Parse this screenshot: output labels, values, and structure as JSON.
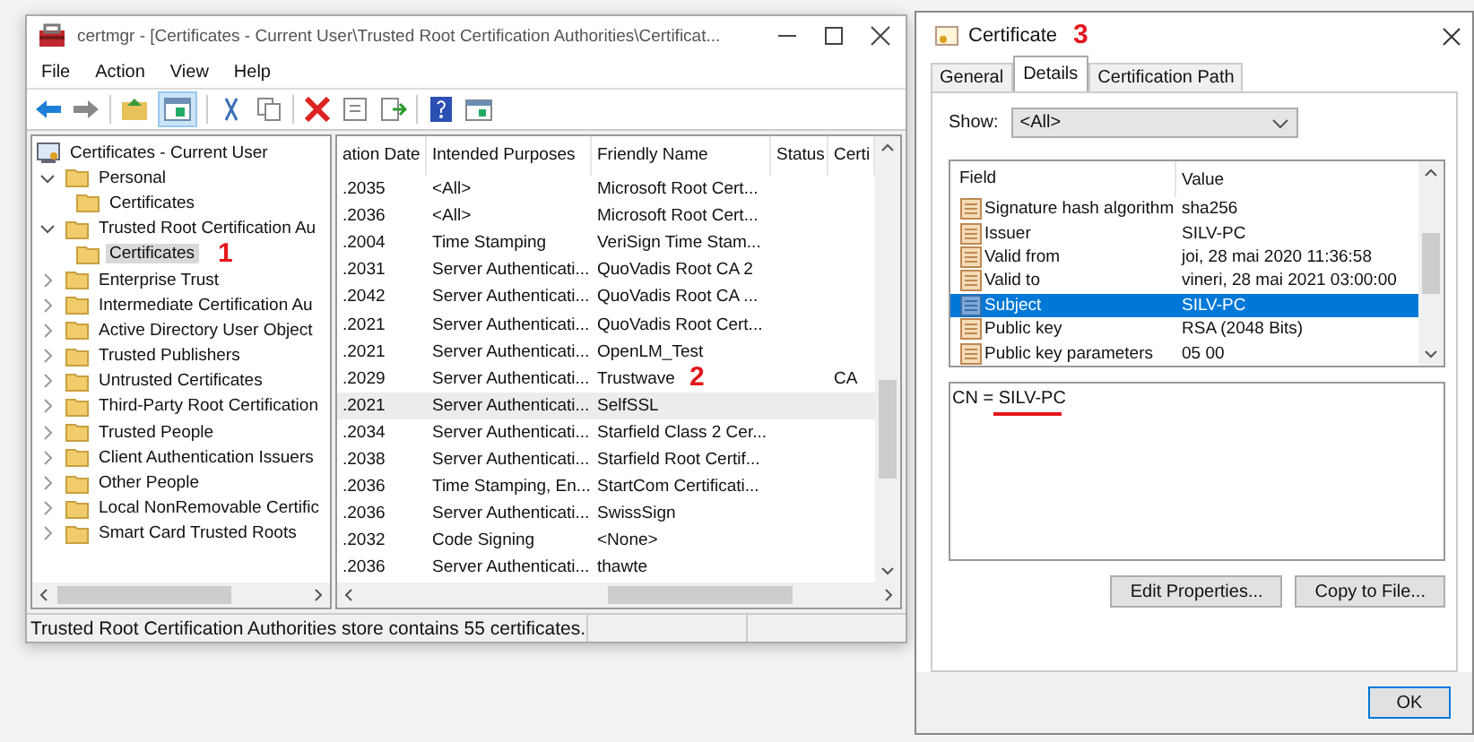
{
  "main_window": {
    "title": "certmgr - [Certificates - Current User\\Trusted Root Certification Authorities\\Certificat...",
    "menu": [
      "File",
      "Action",
      "View",
      "Help"
    ],
    "tree": {
      "label": "Certificates - Current User",
      "children": [
        {
          "label": "Personal",
          "expanded": true,
          "selected": false,
          "children": [
            {
              "label": "Certificates",
              "selected": false
            }
          ]
        },
        {
          "label": "Trusted Root Certification Au",
          "expanded": true,
          "selected": false,
          "children": [
            {
              "label": "Certificates",
              "selected": true,
              "annotation": "1"
            }
          ]
        },
        {
          "label": "Enterprise Trust",
          "expanded": false,
          "selected": false
        },
        {
          "label": "Intermediate Certification Au",
          "expanded": false,
          "selected": false
        },
        {
          "label": "Active Directory User Object",
          "expanded": false,
          "selected": false
        },
        {
          "label": "Trusted Publishers",
          "expanded": false,
          "selected": false
        },
        {
          "label": "Untrusted Certificates",
          "expanded": false,
          "selected": false
        },
        {
          "label": "Third-Party Root Certification",
          "expanded": false,
          "selected": false
        },
        {
          "label": "Trusted People",
          "expanded": false,
          "selected": false
        },
        {
          "label": "Client Authentication Issuers",
          "expanded": false,
          "selected": false
        },
        {
          "label": "Other People",
          "expanded": false,
          "selected": false
        },
        {
          "label": "Local NonRemovable Certific",
          "expanded": false,
          "selected": false
        },
        {
          "label": "Smart Card Trusted Roots",
          "expanded": false,
          "selected": false
        }
      ]
    },
    "table": {
      "columns": [
        "ation Date",
        "Intended Purposes",
        "Friendly Name",
        "Status",
        "Certi"
      ],
      "rows": [
        {
          "cells": [
            ".2035",
            "<All>",
            "Microsoft Root Cert...",
            "",
            ""
          ],
          "selected": false
        },
        {
          "cells": [
            ".2036",
            "<All>",
            "Microsoft Root Cert...",
            "",
            ""
          ],
          "selected": false
        },
        {
          "cells": [
            ".2004",
            "Time Stamping",
            "VeriSign Time Stam...",
            "",
            ""
          ],
          "selected": false
        },
        {
          "cells": [
            ".2031",
            "Server Authenticati...",
            "QuoVadis Root CA 2",
            "",
            ""
          ],
          "selected": false
        },
        {
          "cells": [
            ".2042",
            "Server Authenticati...",
            "QuoVadis Root CA ...",
            "",
            ""
          ],
          "selected": false
        },
        {
          "cells": [
            ".2021",
            "Server Authenticati...",
            "QuoVadis Root Cert...",
            "",
            ""
          ],
          "selected": false
        },
        {
          "cells": [
            ".2021",
            "Server Authenticati...",
            "OpenLM_Test",
            "",
            ""
          ],
          "selected": false
        },
        {
          "cells": [
            ".2029",
            "Server Authenticati...",
            "Trustwave",
            "",
            "CA"
          ],
          "selected": false,
          "annotation": "2"
        },
        {
          "cells": [
            ".2021",
            "Server Authenticati...",
            "SelfSSL",
            "",
            ""
          ],
          "selected": true
        },
        {
          "cells": [
            ".2034",
            "Server Authenticati...",
            "Starfield Class 2 Cer...",
            "",
            ""
          ],
          "selected": false
        },
        {
          "cells": [
            ".2038",
            "Server Authenticati...",
            "Starfield Root Certif...",
            "",
            ""
          ],
          "selected": false
        },
        {
          "cells": [
            ".2036",
            "Time Stamping, En...",
            "StartCom Certificati...",
            "",
            ""
          ],
          "selected": false
        },
        {
          "cells": [
            ".2036",
            "Server Authenticati...",
            "SwissSign",
            "",
            ""
          ],
          "selected": false
        },
        {
          "cells": [
            ".2032",
            "Code Signing",
            "<None>",
            "",
            ""
          ],
          "selected": false
        },
        {
          "cells": [
            ".2036",
            "Server Authenticati...",
            "thawte",
            "",
            ""
          ],
          "selected": false
        }
      ]
    },
    "status_bar": "Trusted Root Certification Authorities store contains 55 certificates."
  },
  "dialog": {
    "title": "Certificate",
    "annotation": "3",
    "tabs": [
      {
        "label": "General",
        "selected": false
      },
      {
        "label": "Details",
        "selected": true
      },
      {
        "label": "Certification Path",
        "selected": false
      }
    ],
    "show": {
      "label": "Show:",
      "value": "<All>"
    },
    "fields": {
      "columns": [
        "Field",
        "Value"
      ],
      "rows": [
        {
          "field": "Signature hash algorithm",
          "value": "sha256",
          "selected": false
        },
        {
          "field": "Issuer",
          "value": "SILV-PC",
          "selected": false
        },
        {
          "field": "Valid from",
          "value": "joi, 28 mai 2020 11:36:58",
          "selected": false
        },
        {
          "field": "Valid to",
          "value": "vineri, 28 mai 2021 03:00:00",
          "selected": false
        },
        {
          "field": "Subject",
          "value": "SILV-PC",
          "selected": true
        },
        {
          "field": "Public key",
          "value": "RSA (2048 Bits)",
          "selected": false
        },
        {
          "field": "Public key parameters",
          "value": "05 00",
          "selected": false
        }
      ]
    },
    "detail": {
      "prefix": "CN = ",
      "value": "SILV-PC",
      "underlined": true
    },
    "buttons": [
      "Edit Properties...",
      "Copy to File..."
    ],
    "ok_button": "OK"
  }
}
